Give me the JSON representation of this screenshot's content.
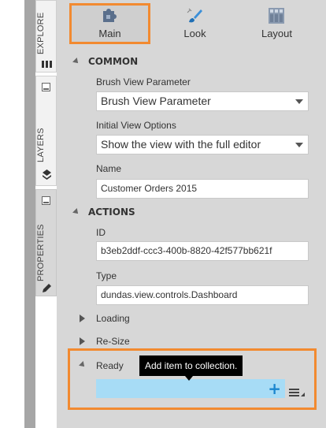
{
  "side_tabs": [
    {
      "label": "EXPLORE",
      "icon": "compass-icon"
    },
    {
      "label": "LAYERS",
      "icon": "layers-icon"
    },
    {
      "label": "PROPERTIES",
      "icon": "pencil-icon"
    }
  ],
  "top_tabs": [
    {
      "label": "Main",
      "icon": "puzzle-icon",
      "selected": true
    },
    {
      "label": "Look",
      "icon": "brush-icon",
      "selected": false
    },
    {
      "label": "Layout",
      "icon": "grid-icon",
      "selected": false
    }
  ],
  "sections": {
    "common": {
      "title": "COMMON",
      "brush_label": "Brush View Parameter",
      "brush_value": "Brush View Parameter",
      "view_label": "Initial View Options",
      "view_value": "Show the view with the full editor",
      "name_label": "Name",
      "name_value": "Customer Orders 2015"
    },
    "actions": {
      "title": "ACTIONS",
      "id_label": "ID",
      "id_value": "b3eb2ddf-ccc3-400b-8820-42f577bb621f",
      "type_label": "Type",
      "type_value": "dundas.view.controls.Dashboard",
      "groups": [
        "Loading",
        "Re-Size"
      ],
      "ready_label": "Ready"
    }
  },
  "tooltip": "Add item to collection.",
  "colors": {
    "highlight": "#f28a30",
    "panel_bg": "#d7d7d7",
    "collection_bar": "#a7dcf6",
    "plus": "#1b86cf"
  }
}
